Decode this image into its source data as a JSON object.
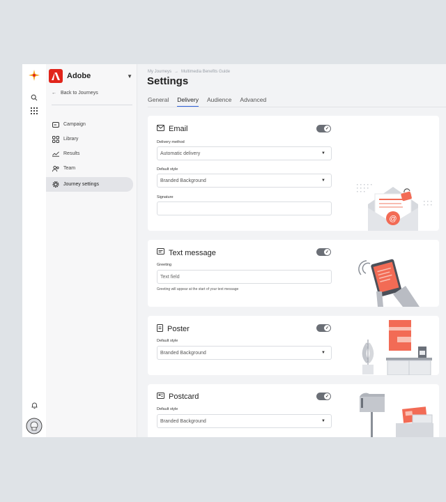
{
  "rail": {
    "icons": [
      "starburst-logo-icon",
      "search-icon",
      "apps-grid-icon",
      "bell-icon",
      "avatar"
    ]
  },
  "sidebar": {
    "brand": "Adobe",
    "back_label": "Back to Journeys",
    "items": [
      {
        "label": "Campaign",
        "icon": "campaign-icon"
      },
      {
        "label": "Library",
        "icon": "library-icon"
      },
      {
        "label": "Results",
        "icon": "results-icon"
      },
      {
        "label": "Team",
        "icon": "team-icon"
      },
      {
        "label": "Journey settings",
        "icon": "gear-icon",
        "active": true
      }
    ]
  },
  "header": {
    "breadcrumb": [
      "My Journeys",
      "Multimedia Benefits Guide"
    ],
    "title": "Settings"
  },
  "tabs": [
    "General",
    "Delivery",
    "Audience",
    "Advanced"
  ],
  "active_tab": "Delivery",
  "cards": {
    "email": {
      "title": "Email",
      "enabled": true,
      "delivery_label": "Delivery method",
      "delivery_value": "Automatic delivery",
      "style_label": "Default style",
      "style_value": "Branded Background",
      "signature_label": "Signature",
      "signature_value": ""
    },
    "text": {
      "title": "Text message",
      "enabled": true,
      "greeting_label": "Greeting",
      "greeting_placeholder": "Text field",
      "greeting_help": "Greeting will appear at the start of your text message"
    },
    "poster": {
      "title": "Poster",
      "enabled": true,
      "style_label": "Default style",
      "style_value": "Branded Background"
    },
    "postcard": {
      "title": "Postcard",
      "enabled": true,
      "style_label": "Default style",
      "style_value": "Branded Background"
    }
  },
  "colors": {
    "accent": "#2c5fd9",
    "brand": "#e1251b",
    "illustration": "#f26b55"
  }
}
